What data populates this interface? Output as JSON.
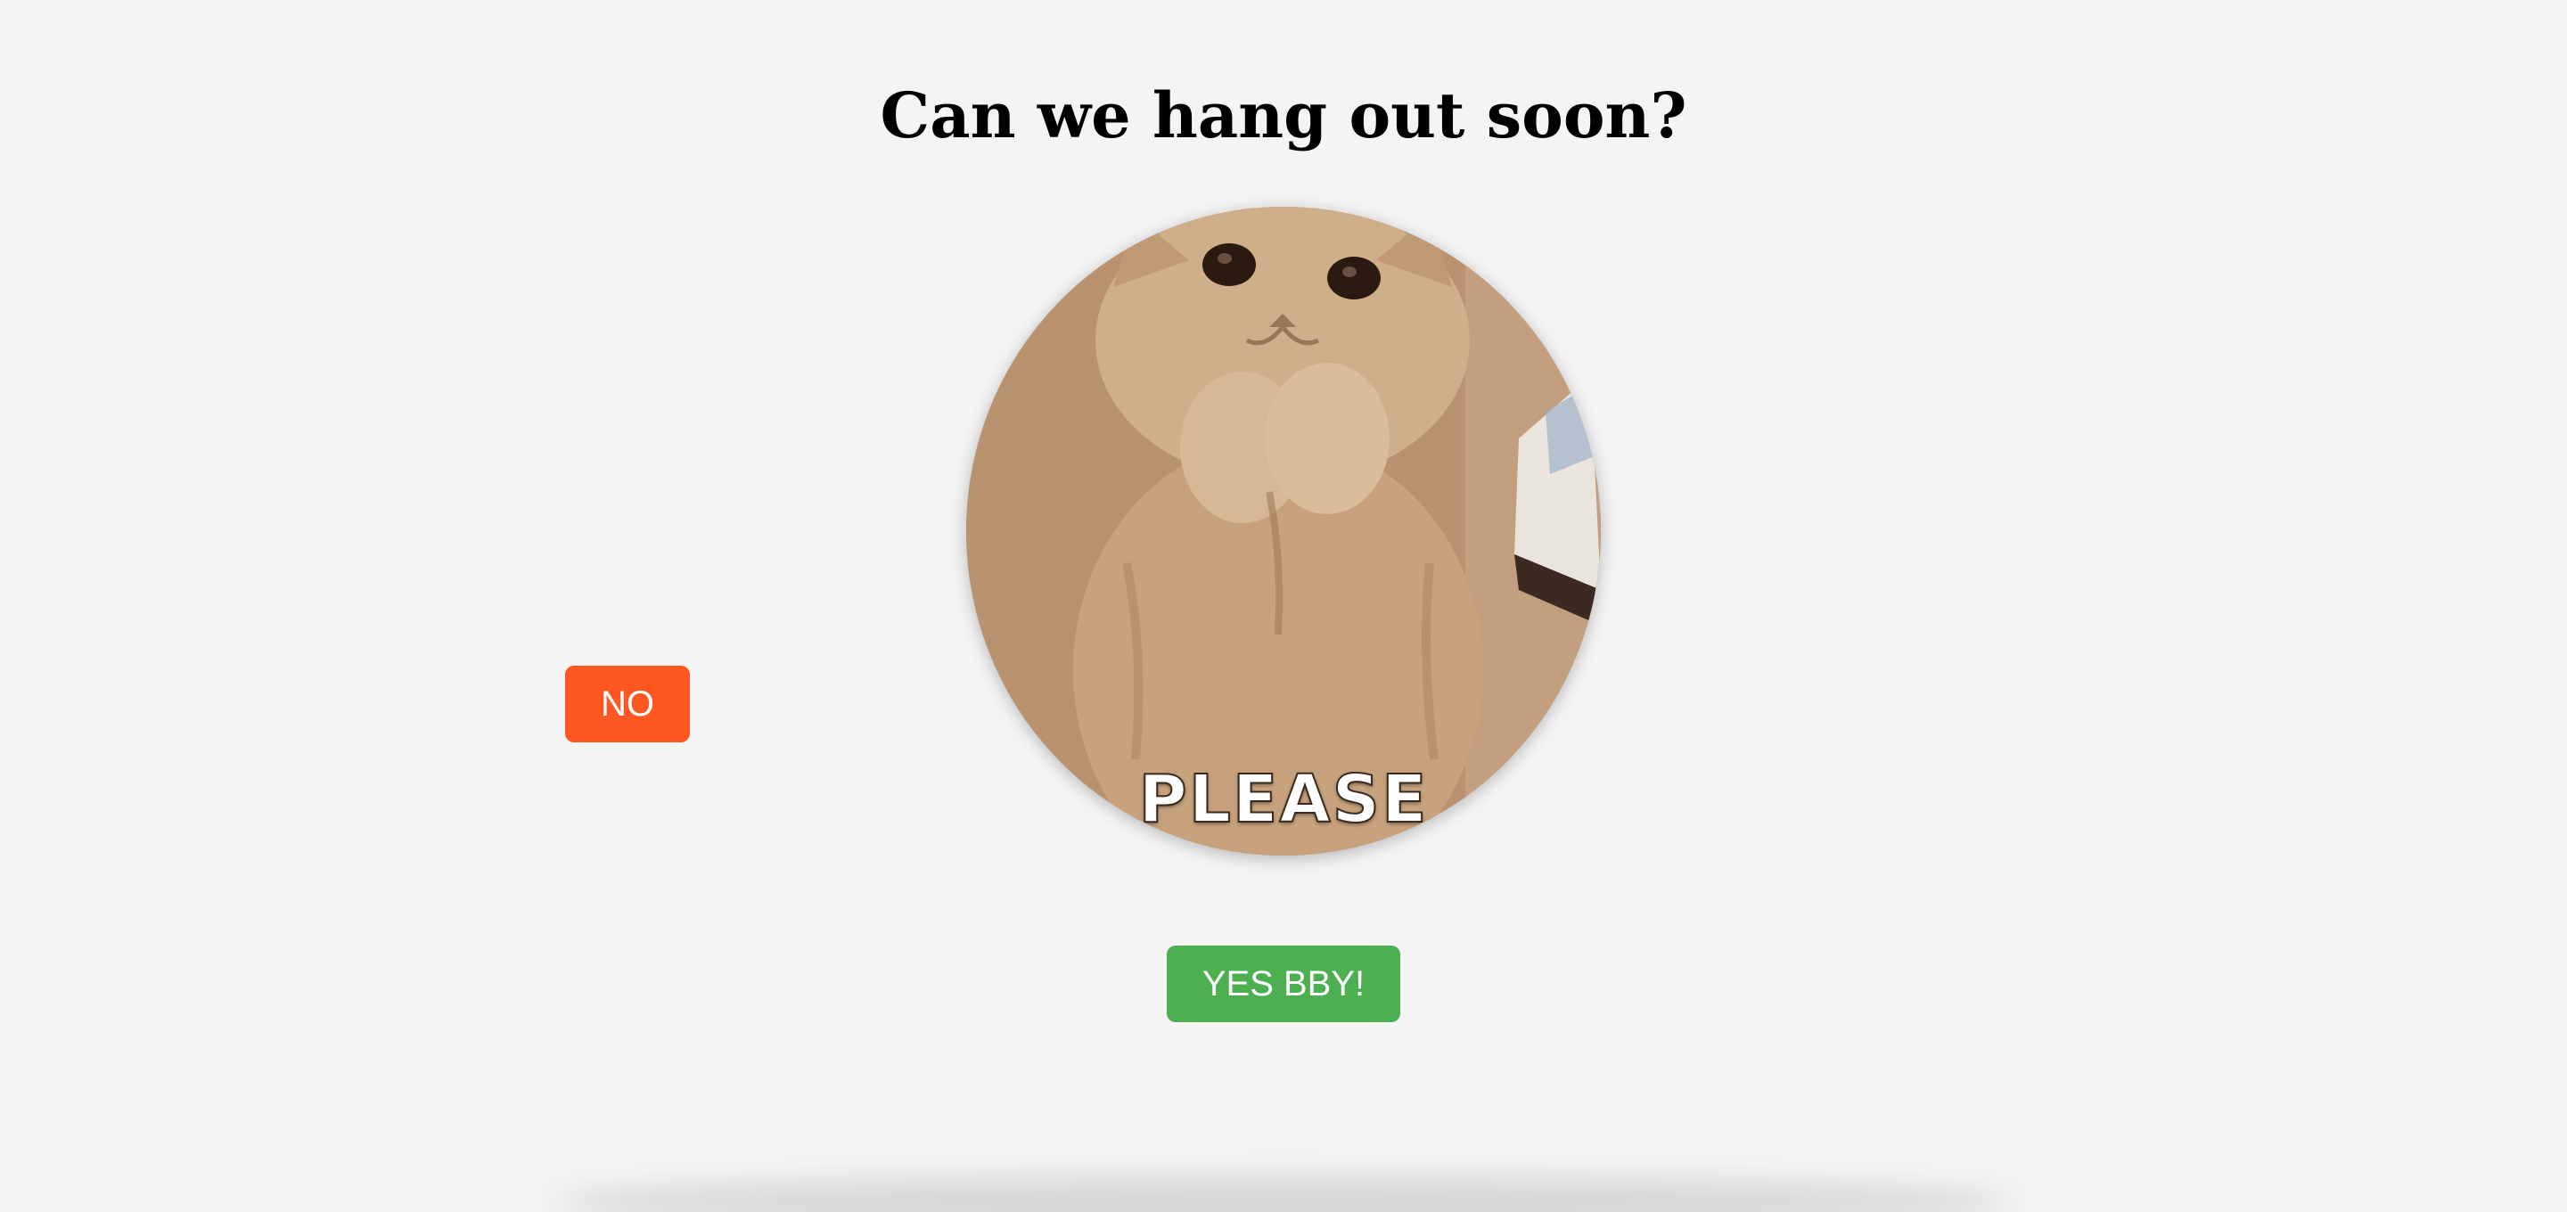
{
  "page": {
    "title": "Can we hang out soon?"
  },
  "image": {
    "caption": "PLEASE",
    "icon": "cat-image"
  },
  "buttons": {
    "no_label": "NO",
    "yes_label": "YES BBY!"
  },
  "colors": {
    "background": "#f4f4f4",
    "no_button": "#ff5722",
    "yes_button": "#4caf50"
  }
}
